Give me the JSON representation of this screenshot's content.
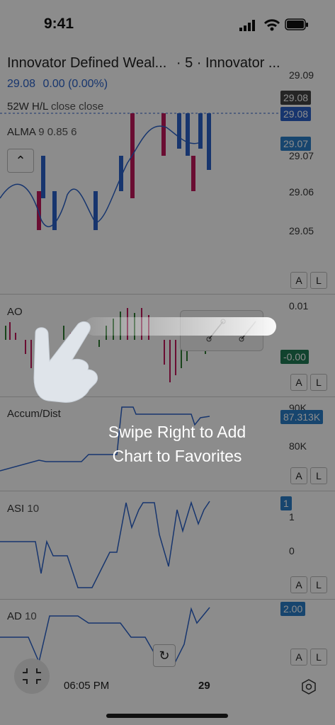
{
  "status_bar": {
    "time": "9:41"
  },
  "header": {
    "title": "Innovator Defined Weal...",
    "interval_info": "· 5 · Innovator ...",
    "price": "29.08",
    "change": "0.00 (0.00%)",
    "line_52w": "52W H/L",
    "line_52w_suffix": "close close",
    "alma": "ALMA",
    "alma_params": "9 0.85 6"
  },
  "price_axis": {
    "labels": [
      "29.09",
      "29.07",
      "29.06",
      "29.05"
    ],
    "tag_high": "29.08",
    "tag_last": "29.08",
    "tag_alma": "29.07"
  },
  "panes": [
    {
      "name": "AO",
      "params": "",
      "axis_top": "0.01",
      "axis_mid": "0.00",
      "tag": "-0.00",
      "tag_color": "#1f7a55"
    },
    {
      "name": "Accum/Dist",
      "params": "",
      "axis_top": "90K",
      "axis_mid": "80K",
      "tag": "87.313K",
      "tag_color": "#2a7ec9"
    },
    {
      "name": "ASI",
      "params": "10",
      "axis_top": "1",
      "axis_mid": "0",
      "tag": "1",
      "tag_color": "#2a7ec9"
    },
    {
      "name": "AD",
      "params": "10",
      "axis_top": "",
      "axis_mid": "",
      "tag": "2.00",
      "tag_color": "#2a7ec9"
    }
  ],
  "scale_buttons": {
    "a": "A",
    "l": "L"
  },
  "time_axis": {
    "time": "06:05 PM",
    "day": "29"
  },
  "tutorial": {
    "line1": "Swipe Right to Add",
    "line2": "Chart to Favorites"
  },
  "icons": {
    "signal": "signal-icon",
    "wifi": "wifi-icon",
    "battery": "battery-icon",
    "collapse": "chevron-up-icon",
    "reset": "reset-icon",
    "fullscreen": "exit-fullscreen-icon",
    "settings": "hexagon-settings-icon",
    "hand": "hand-swipe-icon"
  }
}
